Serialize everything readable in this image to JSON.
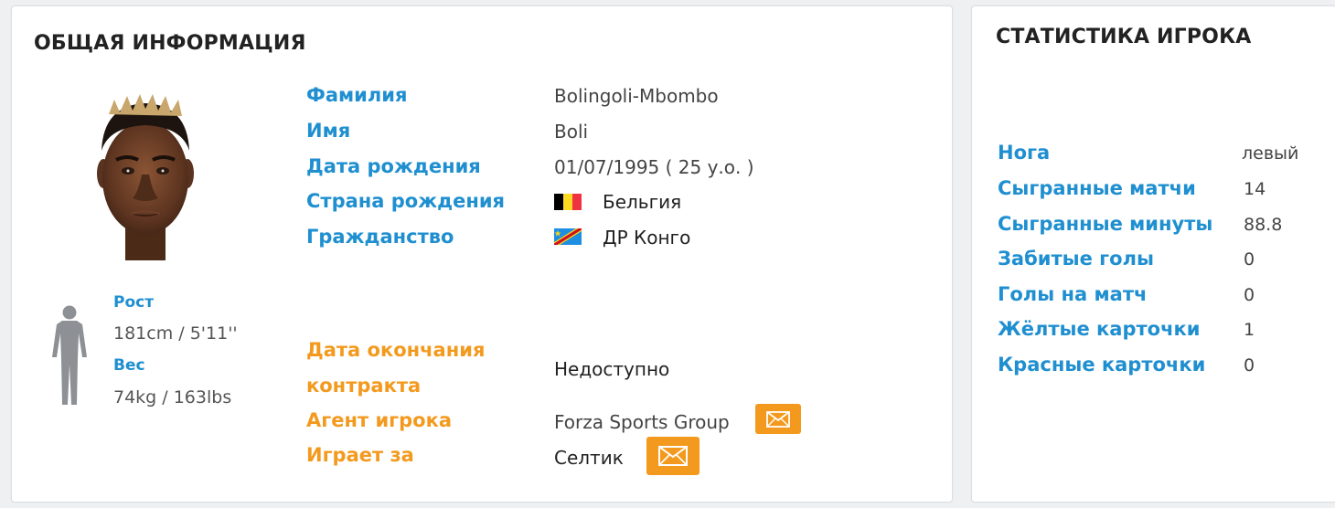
{
  "info": {
    "title": "ОБЩАЯ ИНФОРМАЦИЯ",
    "fields": [
      {
        "label": "Фамилия",
        "value": "Bolingoli-Mbombo"
      },
      {
        "label": "Имя",
        "value": "Boli"
      },
      {
        "label": "Дата рождения",
        "value": "01/07/1995 ( 25 у.о. )"
      },
      {
        "label": "Страна рождения",
        "value": "Бельгия",
        "flag": "belgium-flag"
      },
      {
        "label": "Гражданство",
        "value": "ДР Конго",
        "flag": "dr-congo-flag"
      }
    ],
    "physical": {
      "height_label": "Рост",
      "height_value": "181cm / 5'11''",
      "weight_label": "Вес",
      "weight_value": "74kg / 163lbs"
    },
    "contract": {
      "contract_label_line1": "Дата окончания",
      "contract_label_line2": "контракта",
      "contract_value": "Недоступно",
      "agent_label": "Агент игрока",
      "agent_value": "Forza Sports Group",
      "club_label": "Играет за",
      "club_value": "Селтик"
    }
  },
  "stats": {
    "title": "СТАТИСТИКА ИГРОКА",
    "rows": [
      {
        "label": "Нога",
        "value": "левый"
      },
      {
        "label": "Сыгранные матчи",
        "value": "14"
      },
      {
        "label": "Сыгранные минуты",
        "value": "88.8"
      },
      {
        "label": "Забитые голы",
        "value": "0"
      },
      {
        "label": "Голы на матч",
        "value": "0"
      },
      {
        "label": "Жёлтые карточки",
        "value": "1"
      },
      {
        "label": "Красные карточки",
        "value": "0"
      }
    ]
  },
  "colors": {
    "label_blue": "#1f8fd0",
    "label_orange": "#f39a1e",
    "button_orange": "#f39a1e"
  },
  "icons": {
    "mail": "mail-icon",
    "silhouette": "body-silhouette-icon",
    "photo": "player-photo"
  }
}
